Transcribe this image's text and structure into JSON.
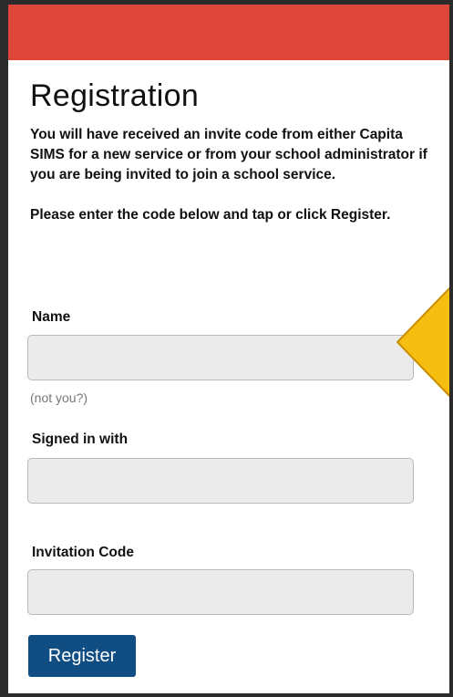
{
  "page": {
    "title": "Registration",
    "intro": "You will have received an invite code from either Capita SIMS for a new service or from your school administrator if you are being invited to join a school service.",
    "instruction": "Please enter the code below and tap or click Register."
  },
  "form": {
    "name_label": "Name",
    "name_value": "",
    "not_you_link": "(not you?)",
    "signed_in_label": "Signed in with",
    "signed_in_value": "",
    "invitation_label": "Invitation Code",
    "invitation_value": "",
    "register_label": "Register"
  },
  "colors": {
    "header_bar": "#de463a",
    "button": "#0f4d82",
    "callout_fill": "#f7be12",
    "callout_outline": "#c98f00"
  }
}
